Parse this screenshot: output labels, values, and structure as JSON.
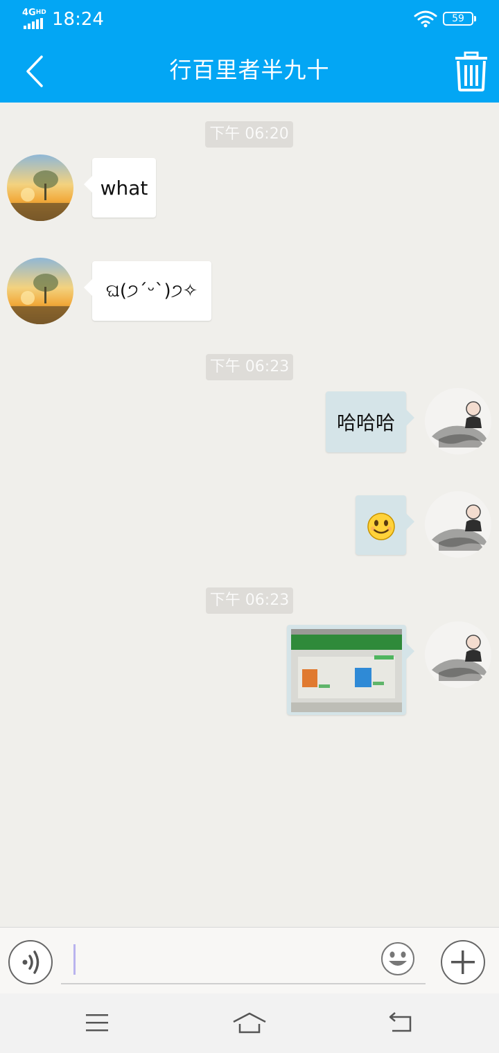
{
  "status_bar": {
    "network": "4G",
    "network_sup": "HD",
    "time": "18:24",
    "battery": "59"
  },
  "header": {
    "title": "行百里者半九十"
  },
  "messages": {
    "time_chip_1": "下午 06:20",
    "time_chip_2": "下午 06:23",
    "time_chip_3": "下午 06:23",
    "msg_1": "what",
    "msg_2": "ଘ(੭ˊᵕˋ)੭✧",
    "msg_3": "哈哈哈",
    "msg_4_emoji": "smiling-face-emoji",
    "msg_5_image": "screenshot-photo"
  },
  "input": {
    "placeholder": ""
  },
  "colors": {
    "accent": "#03a6f4",
    "chat_bg": "#f0efeb",
    "bubble_in": "#ffffff",
    "bubble_out": "#d5e4e8"
  },
  "icons": {
    "back": "chevron-left-icon",
    "delete": "trash-icon",
    "voice": "voice-icon",
    "emoji": "emoji-icon",
    "add": "plus-icon",
    "menu": "menu-icon",
    "home": "home-icon",
    "return": "return-icon"
  }
}
